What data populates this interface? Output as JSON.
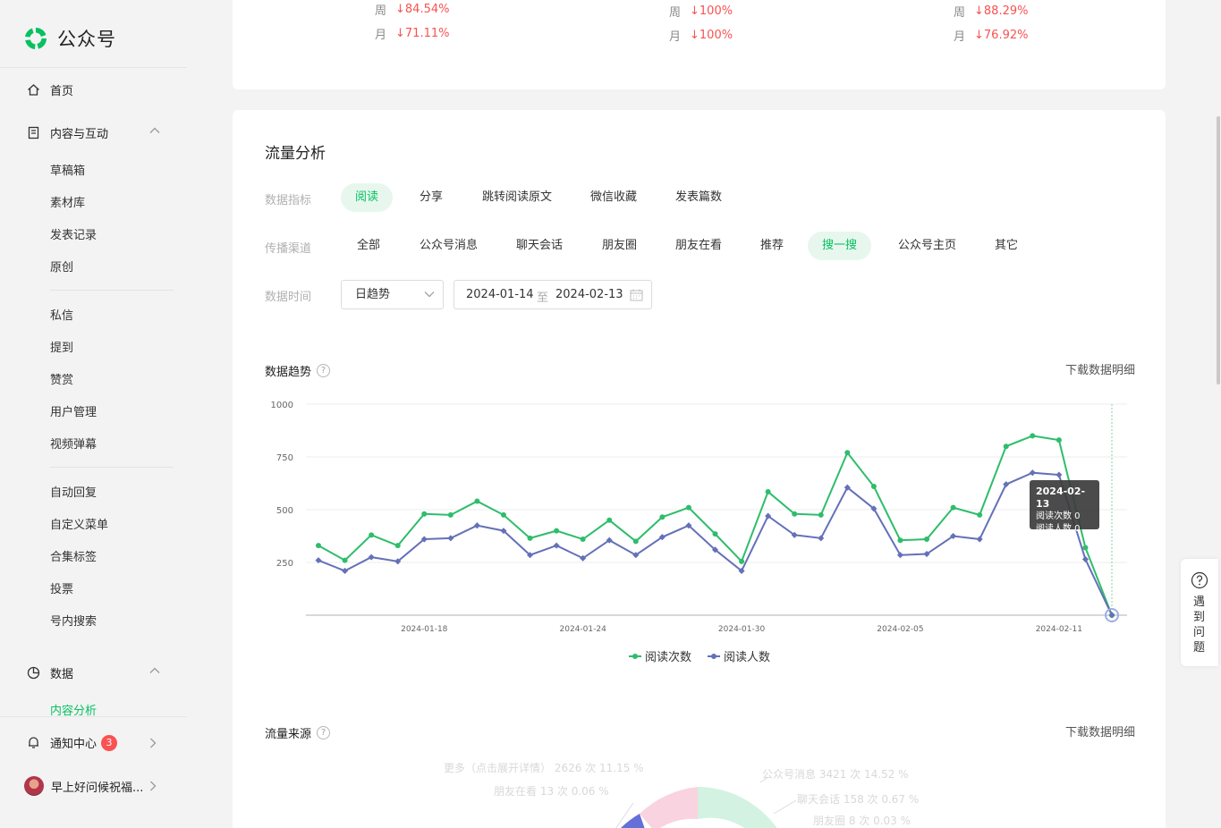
{
  "sidebar": {
    "logo_text": "公众号",
    "home": "首页",
    "content": "内容与互动",
    "content_items": [
      "草稿箱",
      "素材库",
      "发表记录",
      "原创"
    ],
    "interact_items": [
      "私信",
      "提到",
      "赞赏",
      "用户管理",
      "视频弹幕"
    ],
    "function_items": [
      "自动回复",
      "自定义菜单",
      "合集标签",
      "投票",
      "号内搜索"
    ],
    "data": "数据",
    "data_active": "内容分析",
    "notice": "通知中心",
    "notice_count": "3",
    "account": "早上好问候祝福..."
  },
  "stats": [
    {
      "week_label": "周",
      "week_value": "↓84.54%",
      "month_label": "月",
      "month_value": "↓71.11%"
    },
    {
      "week_label": "周",
      "week_value": "↓100%",
      "month_label": "月",
      "month_value": "↓100%"
    },
    {
      "week_label": "周",
      "week_value": "↓88.29%",
      "month_label": "月",
      "month_value": "↓76.92%"
    }
  ],
  "flow": {
    "title": "流量分析",
    "metric_label": "数据指标",
    "metrics": [
      "阅读",
      "分享",
      "跳转阅读原文",
      "微信收藏",
      "发表篇数"
    ],
    "metric_active": 0,
    "channel_label": "传播渠道",
    "channels": [
      "全部",
      "公众号消息",
      "聊天会话",
      "朋友圈",
      "朋友在看",
      "推荐",
      "搜一搜",
      "公众号主页",
      "其它"
    ],
    "channel_active": 6,
    "time_label": "数据时间",
    "trend_select": "日趋势",
    "date_start": "2024-01-14",
    "date_sep": "至",
    "date_end": "2024-02-13",
    "trend_title": "数据趋势",
    "download": "下载数据明细",
    "source_title": "流量来源",
    "source_download": "下载数据明细"
  },
  "tooltip": {
    "date": "2024-02-13",
    "line1": "阅读次数 0",
    "line2": "阅读人数 0"
  },
  "pie_labels": [
    "更多（点击展开详情） 2626 次 11.15 %",
    "朋友在看 13 次 0.06 %",
    "公众号消息 3421 次 14.52 %",
    "聊天会话 158 次 0.67 %",
    "朋友圈 8 次 0.03 %"
  ],
  "help": "遇到问题",
  "colors": {
    "accent": "#07c160",
    "reads": "#2ebd6b",
    "readers": "#6470b8",
    "down": "#fa5151"
  },
  "chart_data": {
    "type": "line",
    "x": [
      "2024-01-14",
      "2024-01-15",
      "2024-01-16",
      "2024-01-17",
      "2024-01-18",
      "2024-01-19",
      "2024-01-20",
      "2024-01-21",
      "2024-01-22",
      "2024-01-23",
      "2024-01-24",
      "2024-01-25",
      "2024-01-26",
      "2024-01-27",
      "2024-01-28",
      "2024-01-29",
      "2024-01-30",
      "2024-01-31",
      "2024-02-01",
      "2024-02-02",
      "2024-02-03",
      "2024-02-04",
      "2024-02-05",
      "2024-02-06",
      "2024-02-07",
      "2024-02-08",
      "2024-02-09",
      "2024-02-10",
      "2024-02-11",
      "2024-02-12",
      "2024-02-13"
    ],
    "xticks": [
      "2024-01-18",
      "2024-01-24",
      "2024-01-30",
      "2024-02-05",
      "2024-02-11"
    ],
    "yticks": [
      250,
      500,
      750,
      1000
    ],
    "ylim": [
      0,
      1000
    ],
    "series": [
      {
        "name": "阅读次数",
        "values": [
          330,
          260,
          380,
          330,
          480,
          475,
          540,
          475,
          365,
          400,
          360,
          450,
          350,
          465,
          510,
          385,
          255,
          585,
          480,
          475,
          770,
          610,
          355,
          360,
          510,
          475,
          800,
          850,
          830,
          320,
          0
        ]
      },
      {
        "name": "阅读人数",
        "values": [
          260,
          210,
          275,
          255,
          360,
          365,
          425,
          400,
          285,
          330,
          270,
          355,
          285,
          370,
          425,
          310,
          210,
          470,
          380,
          365,
          605,
          505,
          285,
          290,
          375,
          360,
          620,
          675,
          665,
          265,
          0
        ]
      }
    ],
    "legend": "bottom"
  }
}
